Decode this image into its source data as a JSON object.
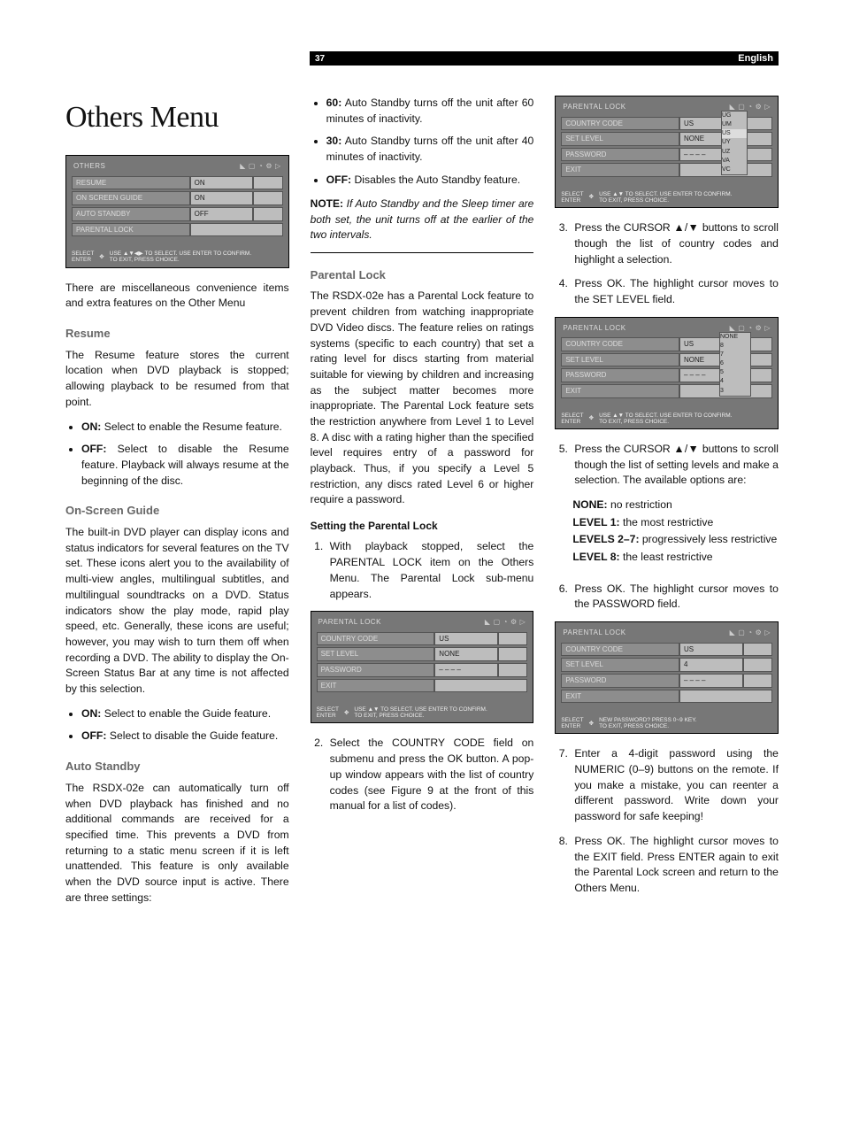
{
  "header": {
    "page_number": "37",
    "language": "English"
  },
  "title": "Others Menu",
  "osd_others": {
    "title": "OTHERS",
    "rows": [
      {
        "label": "RESUME",
        "value": "ON"
      },
      {
        "label": "ON SCREEN GUIDE",
        "value": "ON"
      },
      {
        "label": "AUTO STANDBY",
        "value": "OFF"
      },
      {
        "label": "PARENTAL LOCK",
        "value": ""
      }
    ],
    "footer_left1": "SELECT",
    "footer_left2": "ENTER",
    "footer_right1": "USE",
    "footer_right2": "TO SELECT. USE ENTER TO CONFIRM.",
    "footer_right3": "TO EXIT, PRESS CHOICE.",
    "footer_arrows": "▲▼◀▶"
  },
  "intro": "There are miscellaneous convenience items and extra features on the Other Menu",
  "resume": {
    "heading": "Resume",
    "body": "The Resume feature stores the current location when DVD playback is stopped; allowing playback to be resumed from that point.",
    "bullets": [
      {
        "label": "ON:",
        "text": " Select to enable the Resume feature."
      },
      {
        "label": "OFF:",
        "text": " Select to disable the Resume feature. Playback will always resume at the beginning of the disc."
      }
    ]
  },
  "guide": {
    "heading": "On-Screen Guide",
    "body": "The built-in DVD player can display icons and status indicators for several features on the TV set. These icons alert you to the availability of multi-view angles, multilingual subtitles, and multilingual soundtracks on a DVD. Status indicators show the play mode, rapid play speed, etc. Generally, these icons are useful; however, you may wish to turn them off when recording a DVD. The ability to display the On-Screen Status Bar at any time is not affected by this selection.",
    "bullets": [
      {
        "label": "ON:",
        "text": " Select to enable the Guide feature."
      },
      {
        "label": "OFF:",
        "text": " Select to disable the Guide feature."
      }
    ]
  },
  "standby": {
    "heading": "Auto Standby",
    "body": "The RSDX-02e can automatically turn off when DVD playback has finished and no additional commands are received for a specified time. This prevents a DVD from returning to a static menu screen if it is left unattended. This feature is only available when the DVD source input is active. There are three settings:",
    "bullets": [
      {
        "label": "60:",
        "text": " Auto Standby turns off the unit after 60 minutes of inactivity."
      },
      {
        "label": "30:",
        "text": " Auto Standby turns off the unit after 40 minutes of inactivity."
      },
      {
        "label": "OFF:",
        "text": " Disables the Auto Standby feature."
      }
    ]
  },
  "note": {
    "label": "NOTE:",
    "text": " If Auto Standby and the Sleep timer are both set, the unit turns off at the earlier of the two intervals."
  },
  "parental": {
    "heading": "Parental Lock",
    "body": "The RSDX-02e has a Parental Lock feature to prevent children from watching inappropriate DVD Video discs. The feature relies on ratings systems (specific to each country) that set a rating level for discs starting from material suitable for viewing by children and increasing as the subject matter becomes more inappropriate. The Parental Lock feature sets the restriction anywhere from Level 1 to Level 8. A disc with a rating higher than the specified level requires entry of a password for playback. Thus, if you specify a Level 5 restriction, any discs rated Level 6 or higher require a password.",
    "sub_heading": "Setting the Parental Lock",
    "steps": {
      "s1": "With playback stopped, select the PARENTAL LOCK item on the Others Menu. The Parental Lock sub-menu appears.",
      "s2": "Select the COUNTRY CODE field on submenu and press the OK button. A pop-up window appears with the list of country codes (see Figure 9 at the front of this manual for a list of codes).",
      "s3": "Press the CURSOR ▲/▼ buttons to scroll though the list of country codes and highlight a selection.",
      "s4": "Press OK. The highlight cursor moves to the SET LEVEL field.",
      "s5": "Press the CURSOR ▲/▼ buttons to scroll though the list of setting levels and make a selection. The available options are:",
      "s6": "Press OK. The highlight cursor moves to the PASSWORD field.",
      "s7": "Enter a 4-digit password using the NUMERIC (0–9) buttons on the remote. If you make a mistake, you can reenter a different password. Write down your password for safe keeping!",
      "s8": "Press OK. The highlight cursor moves to the EXIT field. Press ENTER again to exit the Parental Lock screen and return to the Others Menu."
    },
    "options": {
      "none": {
        "label": "NONE:",
        "text": " no restriction"
      },
      "l1": {
        "label": "LEVEL 1:",
        "text": " the most restrictive"
      },
      "l27": {
        "label": "LEVELS 2–7:",
        "text": " progressively less restrictive"
      },
      "l8": {
        "label": "LEVEL 8:",
        "text": " the least restrictive"
      }
    }
  },
  "osd_pl1": {
    "title": "PARENTAL LOCK",
    "rows": [
      {
        "label": "COUNTRY CODE",
        "value": "US"
      },
      {
        "label": "SET LEVEL",
        "value": "NONE"
      },
      {
        "label": "PASSWORD",
        "value": "– – – –"
      },
      {
        "label": "EXIT",
        "value": ""
      }
    ],
    "footer_right1": "USE ▲▼ TO SELECT. USE ENTER TO CONFIRM.",
    "footer_right2": "TO EXIT, PRESS CHOICE."
  },
  "osd_pl2": {
    "title": "PARENTAL LOCK",
    "rows": [
      {
        "label": "COUNTRY CODE",
        "value": "US"
      },
      {
        "label": "SET LEVEL",
        "value": "NONE"
      },
      {
        "label": "PASSWORD",
        "value": "– – – –"
      },
      {
        "label": "EXIT",
        "value": ""
      }
    ],
    "dropdown": [
      "UG",
      "UM",
      "US",
      "UY",
      "UZ",
      "VA",
      "VC"
    ],
    "footer_right1": "USE ▲▼ TO SELECT. USE ENTER TO CONFIRM.",
    "footer_right2": "TO EXIT, PRESS CHOICE."
  },
  "osd_pl3": {
    "title": "PARENTAL LOCK",
    "rows": [
      {
        "label": "COUNTRY CODE",
        "value": "US"
      },
      {
        "label": "SET LEVEL",
        "value": "NONE"
      },
      {
        "label": "PASSWORD",
        "value": "– – – –"
      },
      {
        "label": "EXIT",
        "value": ""
      }
    ],
    "dropdown": [
      "NONE",
      "8",
      "7",
      "6",
      "5",
      "4",
      "3"
    ],
    "footer_right1": "USE ▲▼ TO SELECT. USE ENTER TO CONFIRM.",
    "footer_right2": "TO EXIT, PRESS CHOICE."
  },
  "osd_pl4": {
    "title": "PARENTAL LOCK",
    "rows": [
      {
        "label": "COUNTRY CODE",
        "value": "US"
      },
      {
        "label": "SET LEVEL",
        "value": "4"
      },
      {
        "label": "PASSWORD",
        "value": "– – – –"
      },
      {
        "label": "EXIT",
        "value": ""
      }
    ],
    "footer_right1": "NEW PASSWORD? PRESS 0~9 KEY.",
    "footer_right2": "TO EXIT, PRESS CHOICE."
  }
}
